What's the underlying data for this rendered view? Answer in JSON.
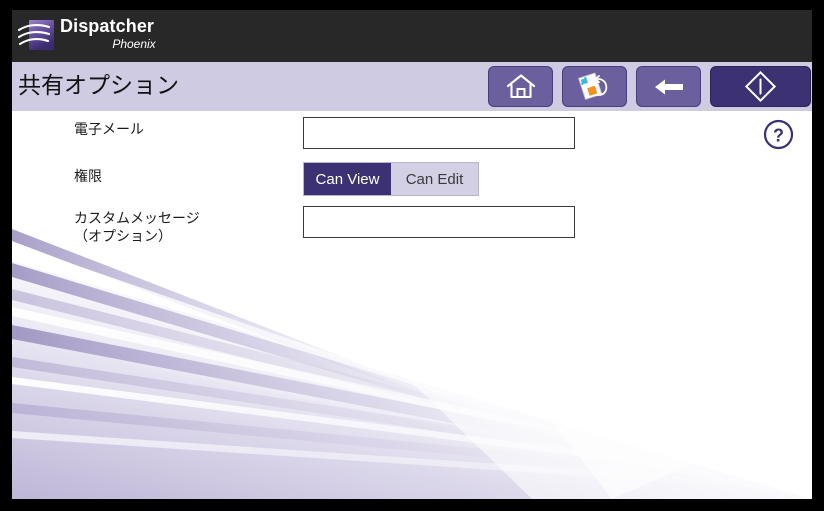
{
  "brand": {
    "logo_icon": "dispatcher-waves-logo",
    "title": "Dispatcher",
    "subtitle": "Phoenix"
  },
  "title_bar": {
    "page_title": "共有オプション",
    "toolbar": [
      {
        "name": "home-button",
        "icon": "home-icon",
        "label": "Home"
      },
      {
        "name": "reset-button",
        "icon": "document-undo-icon",
        "label": "Reset"
      },
      {
        "name": "back-button",
        "icon": "arrow-left-icon",
        "label": "Back"
      },
      {
        "name": "start-button",
        "icon": "diamond-start-icon",
        "label": "Start"
      }
    ]
  },
  "form": {
    "email": {
      "label": "電子メール",
      "value": "",
      "placeholder": ""
    },
    "permission": {
      "label": "権限",
      "selected": "Can View",
      "options": [
        "Can View",
        "Can Edit"
      ]
    },
    "custom_message": {
      "label_line1": "カスタムメッセージ",
      "label_line2": "（オプション）",
      "value": "",
      "placeholder": ""
    }
  },
  "help": {
    "icon": "question-mark-circle-icon",
    "label": "Help"
  },
  "colors": {
    "header_bg": "#282828",
    "title_bar_bg": "#cfcbe2",
    "toolbar_btn": "#6b5f9e",
    "toolbar_btn_primary": "#3c3173",
    "accent_purple": "#3c3173",
    "toggle_off_bg": "#d3cfe4",
    "help_icon": "#3c3173",
    "content_bg": "#ffffff"
  }
}
